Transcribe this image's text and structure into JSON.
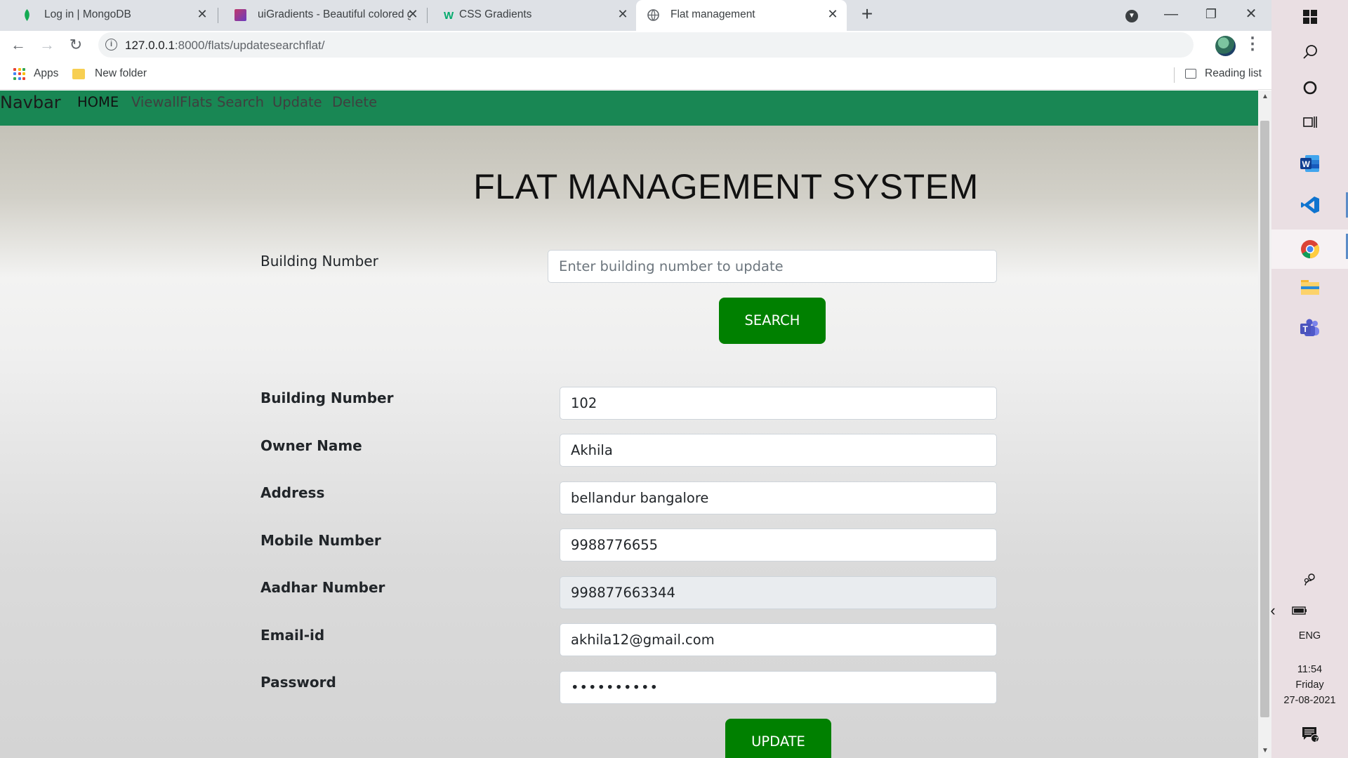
{
  "browser": {
    "tabs": [
      {
        "title": "Log in | MongoDB"
      },
      {
        "title": "uiGradients - Beautiful colored g"
      },
      {
        "title": "CSS Gradients"
      },
      {
        "title": "Flat management"
      }
    ],
    "url_host": "127.0.0.1",
    "url_path": ":8000/flats/updatesearchflat/",
    "bookmarks": {
      "apps": "Apps",
      "folder": "New folder",
      "reading_list": "Reading list"
    }
  },
  "navbar": {
    "brand": "Navbar",
    "links": [
      "HOME",
      "ViewallFlats",
      "Search",
      "Update",
      "Delete"
    ]
  },
  "page": {
    "heading": "FLAT MANAGEMENT SYSTEM",
    "search": {
      "label": "Building Number",
      "placeholder": "Enter building number to update",
      "button": "SEARCH"
    },
    "form": {
      "fields": [
        {
          "label": "Building Number",
          "value": "102"
        },
        {
          "label": "Owner Name",
          "value": "Akhila"
        },
        {
          "label": "Address",
          "value": "bellandur bangalore"
        },
        {
          "label": "Mobile Number",
          "value": "9988776655"
        },
        {
          "label": "Aadhar Number",
          "value": "998877663344"
        },
        {
          "label": "Email-id",
          "value": "akhila12@gmail.com"
        },
        {
          "label": "Password",
          "value": "••••••••••"
        }
      ],
      "button": "UPDATE"
    }
  },
  "taskbar": {
    "lang": "ENG",
    "time": "11:54",
    "day": "Friday",
    "date": "27-08-2021",
    "notifications": "7"
  },
  "colors": {
    "navbar": "#198754",
    "button": "#008000"
  }
}
